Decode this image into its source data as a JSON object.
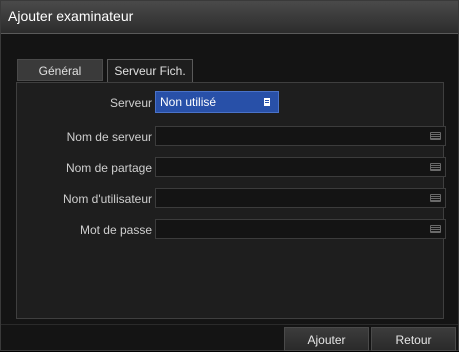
{
  "window": {
    "title": "Ajouter examinateur"
  },
  "tabs": [
    {
      "label": "Général",
      "active": false
    },
    {
      "label": "Serveur Fich.",
      "active": true
    }
  ],
  "form": {
    "server": {
      "label": "Serveur",
      "value": "Non utilisé",
      "icon": "list-icon"
    },
    "server_name": {
      "label": "Nom de serveur",
      "value": "",
      "icon": "keyboard-icon"
    },
    "share_name": {
      "label": "Nom de partage",
      "value": "",
      "icon": "keyboard-icon"
    },
    "username": {
      "label": "Nom d'utilisateur",
      "value": "",
      "icon": "keyboard-icon"
    },
    "password": {
      "label": "Mot de passe",
      "value": "",
      "icon": "keyboard-icon"
    }
  },
  "buttons": {
    "add": "Ajouter",
    "back": "Retour"
  },
  "colors": {
    "select_bg": "#2850a8",
    "window_bg": "#141414",
    "titlebar": "#3a3a3a"
  }
}
